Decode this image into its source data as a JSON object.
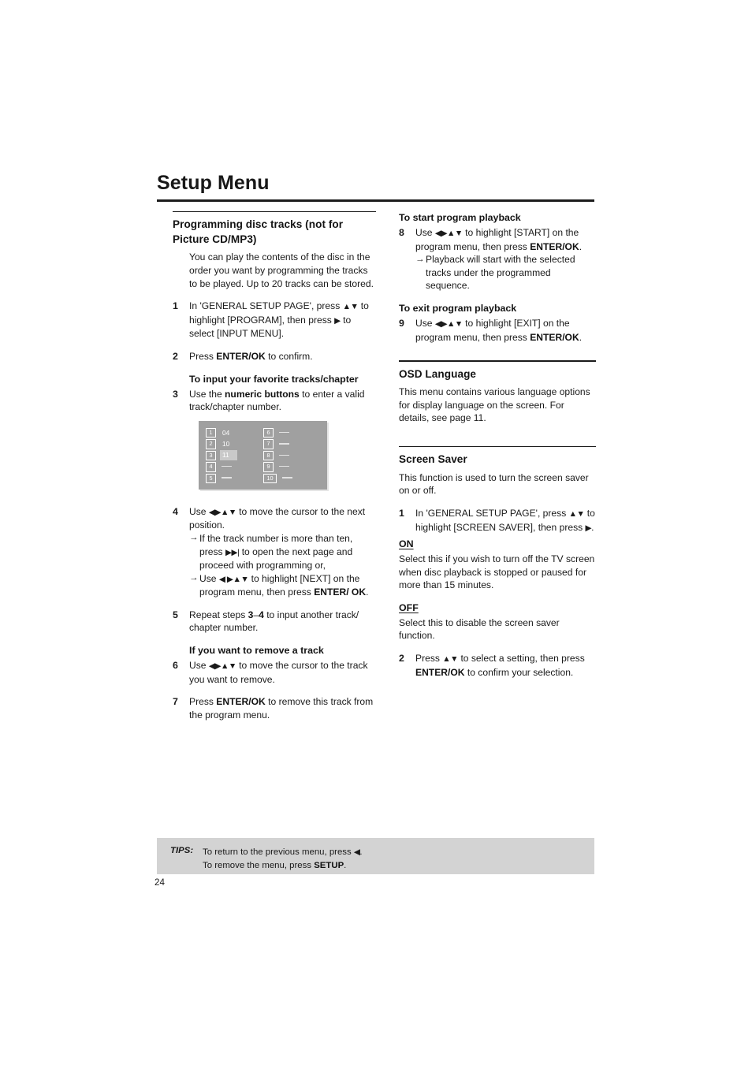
{
  "page": {
    "chapter_title": "Setup Menu",
    "page_number": "24"
  },
  "left_column": {
    "section_title_line1": "Programming disc tracks (not for",
    "section_title_line2": "Picture CD/MP3)",
    "intro": "You can play the contents of the disc in the order you want by programming the tracks to be played. Up to 20 tracks can be stored.",
    "step1": {
      "num": "1",
      "part1": "In 'GENERAL SETUP PAGE', press ",
      "keys1": "▲▼",
      "part2": " to highlight [PROGRAM], then press ",
      "keys2": "▶",
      "part3": " to select [INPUT MENU]."
    },
    "step2": {
      "num": "2",
      "part1": "Press ",
      "bold1": "ENTER/OK",
      "part2": " to confirm."
    },
    "subheading_input": "To input your favorite tracks/chapter",
    "step3": {
      "num": "3",
      "part1": "Use the ",
      "bold1": "numeric buttons",
      "part2": " to enter a valid track/chapter number."
    },
    "step4": {
      "num": "4",
      "keys1": "◀▶▲▼",
      "part1": "Use ",
      "part2": " to move the cursor to the next position.",
      "arrow1": {
        "glyph": "→",
        "part1": "If the track number is more than ten, press ",
        "keys": "▶▶|",
        "part2": " to open the next page and proceed with programming or,"
      },
      "arrow2": {
        "glyph": "→",
        "part1": "Use ",
        "keys": "◀ ▶▲▼",
        "part2": " to highlight [NEXT] on the program menu, then press ",
        "bold1": "ENTER/ OK",
        "part3": "."
      }
    },
    "step5": {
      "num": "5",
      "part1": "Repeat steps ",
      "bold1": "3",
      "dash": "–",
      "bold2": "4",
      "part2": " to input another track/ chapter number."
    },
    "subheading_remove": "If you want to remove a track",
    "step6": {
      "num": "6",
      "part1": "Use ",
      "keys1": "◀▶▲▼",
      "part2": " to move the cursor to the track you want to remove."
    },
    "step7": {
      "num": "7",
      "part1": "Press ",
      "bold1": "ENTER/OK",
      "part2": " to remove this track from the program menu."
    }
  },
  "figure": {
    "name": "program-menu-screen",
    "background_color": "#a0a0a0",
    "highlight_color": "#c9c9c9",
    "column1": [
      {
        "index": "1",
        "value": "04",
        "highlighted": false,
        "blank": false
      },
      {
        "index": "2",
        "value": "10",
        "highlighted": false,
        "blank": false
      },
      {
        "index": "3",
        "value": "11",
        "highlighted": true,
        "blank": false
      },
      {
        "index": "4",
        "value": "",
        "highlighted": false,
        "blank": true
      },
      {
        "index": "5",
        "value": "",
        "highlighted": false,
        "blank": true
      }
    ],
    "column2": [
      {
        "index": "6",
        "value": "",
        "highlighted": false,
        "blank": true
      },
      {
        "index": "7",
        "value": "",
        "highlighted": false,
        "blank": true
      },
      {
        "index": "8",
        "value": "",
        "highlighted": false,
        "blank": true
      },
      {
        "index": "9",
        "value": "",
        "highlighted": false,
        "blank": true
      },
      {
        "index": "10",
        "value": "",
        "highlighted": false,
        "blank": true
      }
    ]
  },
  "right_column": {
    "subheading_start": "To start program playback",
    "step8": {
      "num": "8",
      "part1": "Use ",
      "keys1": "◀▶▲▼",
      "part2": " to highlight [START] on the program menu, then press ",
      "bold1": "ENTER/OK",
      "part3": ".",
      "arrow1": {
        "glyph": "→",
        "text": "Playback will start with the selected tracks under the programmed sequence."
      }
    },
    "subheading_exit": "To exit program playback",
    "step9": {
      "num": "9",
      "part1": "Use ",
      "keys1": "◀▶▲▼",
      "part2": " to highlight [EXIT] on the program menu, then press ",
      "bold1": "ENTER/OK",
      "part3": "."
    },
    "osd": {
      "title": "OSD Language",
      "body": "This menu contains various language options for display language on the screen. For details, see page 11."
    },
    "screensaver": {
      "title": "Screen Saver",
      "body": "This function is used to turn the screen saver on or off.",
      "step1": {
        "num": "1",
        "part1": "In 'GENERAL SETUP PAGE', press ",
        "keys1": "▲▼",
        "part2": " to highlight [SCREEN SAVER], then press ",
        "keys2": "▶",
        "part3": "."
      },
      "on_label": "ON",
      "on_body": "Select this if you wish to turn off the TV screen when disc playback is stopped or paused for more than 15 minutes.",
      "off_label": "OFF",
      "off_body": "Select this to disable the screen saver function.",
      "step2": {
        "num": "2",
        "part1": "Press ",
        "keys1": "▲▼",
        "part2": " to select a setting, then press ",
        "bold1": "ENTER/OK",
        "part3": " to confirm your selection."
      }
    }
  },
  "tips": {
    "label": "TIPS:",
    "line1_part1": "To return to the previous menu, press ",
    "line1_key": "◀",
    "line1_part2": ".",
    "line2_part1": "To remove the menu, press ",
    "line2_bold": "SETUP",
    "line2_part2": "."
  }
}
